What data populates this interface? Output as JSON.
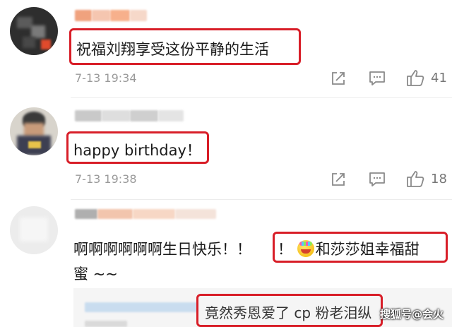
{
  "comments": [
    {
      "text": "祝福刘翔享受这份平静的生活",
      "time": "7-13 19:34",
      "likes": "41"
    },
    {
      "text": "happy birthday！",
      "time": "7-13 19:38",
      "likes": "18"
    },
    {
      "text_part1": "啊啊啊啊啊啊生日快乐！！",
      "text_part2": "！",
      "text_part3": "和莎莎姐幸福甜",
      "text_line2": "蜜 ~~",
      "reply_text": "竟然秀恩爱了 cp 粉老泪纵"
    }
  ],
  "watermark": "搜狐号@会火",
  "colors": {
    "highlight": "#d81e28",
    "time": "#9a9a9a",
    "icon": "#8a8a8a"
  },
  "icons": [
    "share-icon",
    "comment-icon",
    "like-icon",
    "emoji-party-icon"
  ]
}
